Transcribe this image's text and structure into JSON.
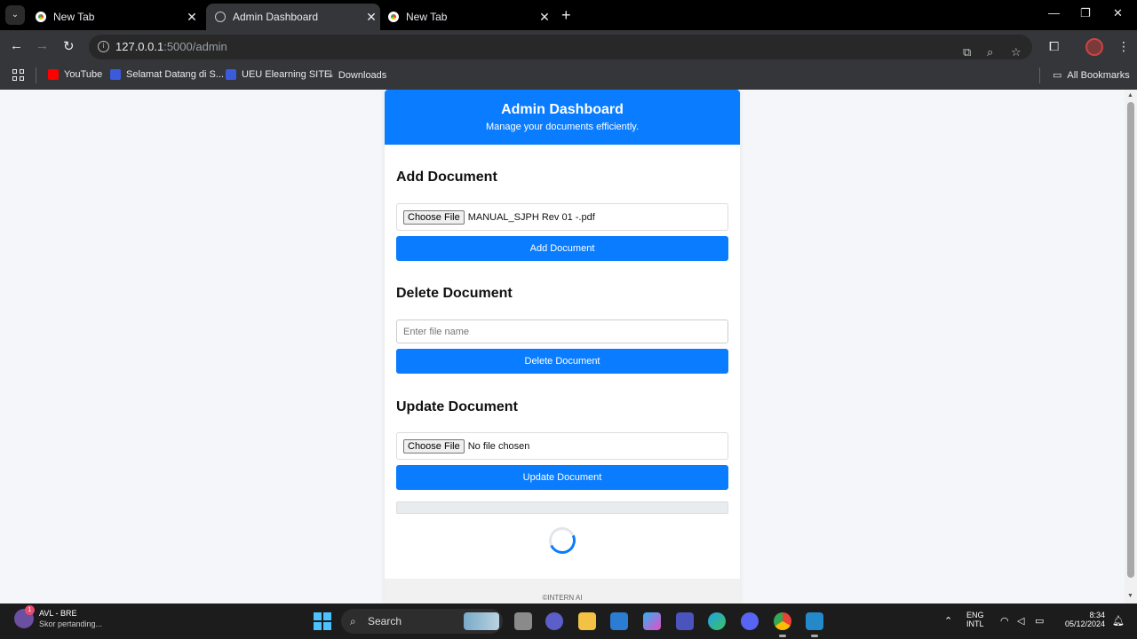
{
  "browser": {
    "tabs": [
      {
        "title": "New Tab",
        "active": false
      },
      {
        "title": "Admin Dashboard",
        "active": true
      },
      {
        "title": "New Tab",
        "active": false
      }
    ],
    "url_host": "127.0.0.1",
    "url_path": ":5000/admin",
    "bookmarks": [
      {
        "label": "YouTube",
        "icon": "youtube-icon"
      },
      {
        "label": "Selamat Datang di S...",
        "icon": "site-icon"
      },
      {
        "label": "UEU Elearning SITE",
        "icon": "site-icon"
      },
      {
        "label": "Downloads",
        "icon": "download-icon"
      }
    ],
    "all_bookmarks": "All Bookmarks"
  },
  "header": {
    "title": "Admin Dashboard",
    "subtitle": "Manage your documents efficiently."
  },
  "add_section": {
    "heading": "Add Document",
    "choose_label": "Choose File",
    "file_name": "MANUAL_SJPH Rev 01 -.pdf",
    "button": "Add Document"
  },
  "delete_section": {
    "heading": "Delete Document",
    "placeholder": "Enter file name",
    "button": "Delete Document"
  },
  "update_section": {
    "heading": "Update Document",
    "choose_label": "Choose File",
    "file_name": "No file chosen",
    "button": "Update Document"
  },
  "progress": {
    "value": 0
  },
  "footer": {
    "text": "©INTERN AI"
  },
  "colors": {
    "primary": "#0a7cff",
    "page_bg": "#f4f6f9"
  },
  "taskbar": {
    "weather_title": "AVL - BRE",
    "weather_sub": "Skor pertanding...",
    "badge": "1",
    "search": "Search",
    "lang1": "ENG",
    "lang2": "INTL",
    "time": "8:34",
    "date": "05/12/2024"
  }
}
